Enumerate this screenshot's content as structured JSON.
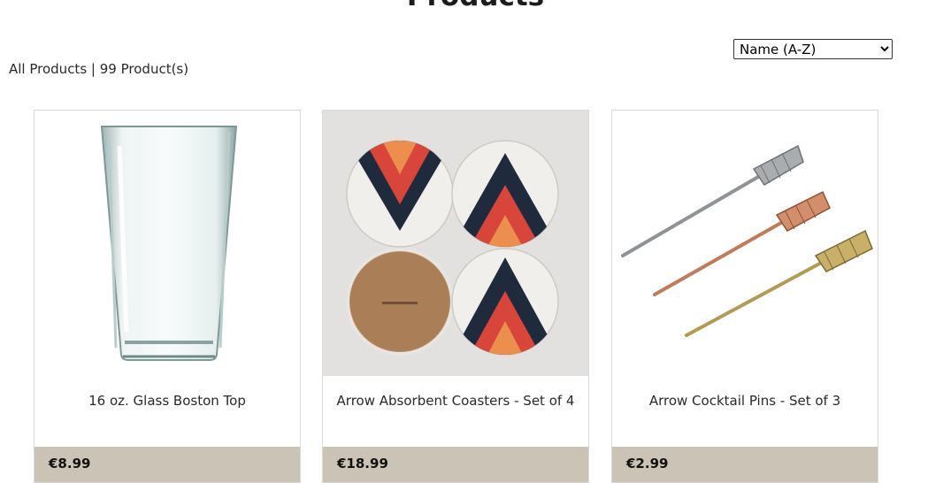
{
  "page": {
    "title": "Products"
  },
  "sort": {
    "selected": "Name (A-Z)"
  },
  "summary": {
    "category": "All Products",
    "separator": "|",
    "count_text": "99 Product(s)"
  },
  "products": [
    {
      "name": "16 oz. Glass Boston Top",
      "price": "€8.99",
      "image_icon": "pint-glass-icon"
    },
    {
      "name": "Arrow Absorbent Coasters - Set of 4",
      "price": "€18.99",
      "image_icon": "arrow-coasters-icon"
    },
    {
      "name": "Arrow Cocktail Pins - Set of 3",
      "price": "€2.99",
      "image_icon": "arrow-cocktail-pins-icon"
    }
  ],
  "colors": {
    "price_bar": "#cbc3b5",
    "coaster_red": "#d8453a",
    "coaster_orange": "#ec8f4e",
    "coaster_navy": "#1f2a3c"
  }
}
